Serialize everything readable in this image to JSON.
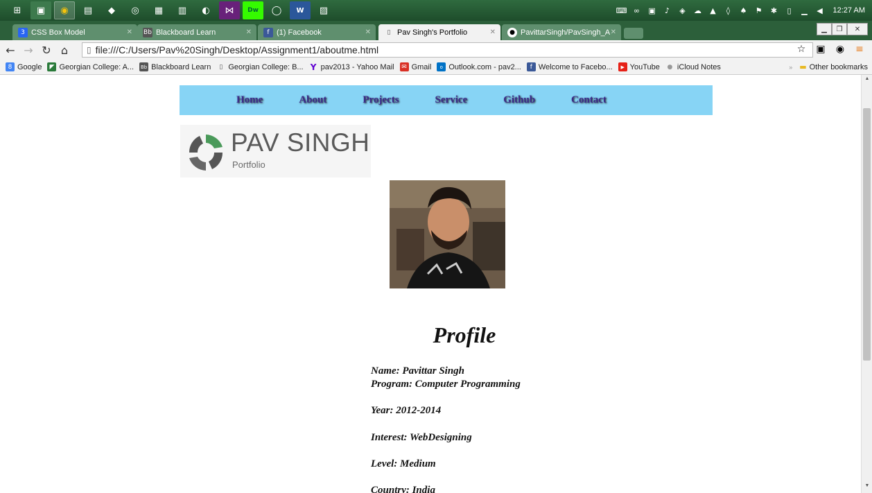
{
  "taskbar": {
    "icons": [
      "windows-start",
      "file-explorer",
      "chrome",
      "notepad",
      "app-1",
      "app-2",
      "app-3",
      "app-4",
      "app-5",
      "visual-studio",
      "dreamweaver",
      "app-6",
      "word",
      "app-7"
    ],
    "clock": "12:27 AM"
  },
  "tabs": [
    {
      "label": "CSS Box Model",
      "favicon": "css3"
    },
    {
      "label": "Blackboard Learn",
      "favicon": "blackboard"
    },
    {
      "label": "(1) Facebook",
      "favicon": "facebook"
    },
    {
      "label": "Pav Singh's Portfolio",
      "favicon": "page"
    },
    {
      "label": "PavittarSingh/PavSingh_A",
      "favicon": "github"
    }
  ],
  "address_bar": {
    "url": "file:///C:/Users/Pav%20Singh/Desktop/Assignment1/aboutme.html"
  },
  "bookmarks": [
    {
      "label": "Google",
      "icon": "google"
    },
    {
      "label": "Georgian College: A...",
      "icon": "georgian"
    },
    {
      "label": "Blackboard Learn",
      "icon": "blackboard"
    },
    {
      "label": "Georgian College: B...",
      "icon": "page"
    },
    {
      "label": "pav2013 - Yahoo Mail",
      "icon": "yahoo"
    },
    {
      "label": "Gmail",
      "icon": "gmail"
    },
    {
      "label": "Outlook.com - pav2...",
      "icon": "outlook"
    },
    {
      "label": "Welcome to Facebo...",
      "icon": "facebook"
    },
    {
      "label": "YouTube",
      "icon": "youtube"
    },
    {
      "label": "iCloud Notes",
      "icon": "apple"
    }
  ],
  "other_bookmarks": "Other bookmarks",
  "site": {
    "nav": [
      "Home",
      "About",
      "Projects",
      "Service",
      "Github",
      "Contact"
    ],
    "logo_name": "PAV SINGH",
    "logo_sub": "Portfolio",
    "profile_heading": "Profile",
    "profile_lines": [
      "Name: Pavittar Singh",
      "Program: Computer Programming",
      "Year: 2012-2014",
      "Interest: WebDesigning",
      "Level: Medium",
      "Country: India"
    ]
  }
}
